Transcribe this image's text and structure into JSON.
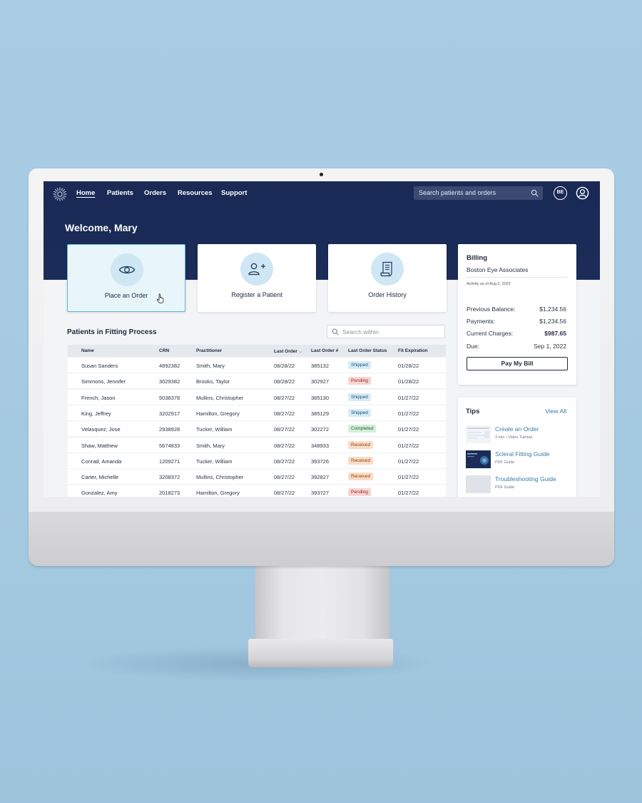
{
  "nav": {
    "items": [
      "Home",
      "Patients",
      "Orders",
      "Resources",
      "Support"
    ],
    "search_placeholder": "Search patients and orders",
    "avatar_initials": "BE"
  },
  "welcome": "Welcome, Mary",
  "actions": [
    "Place an Order",
    "Register a Patient",
    "Order History"
  ],
  "patients": {
    "title": "Patients in Fitting Process",
    "search_placeholder": "Search within",
    "columns": [
      "Name",
      "CRN",
      "Practitioner",
      "Last Order",
      "Last Order #",
      "Last Order Status",
      "Fit Expiration"
    ],
    "rows": [
      {
        "name": "Susan Sanders",
        "crn": "4892382",
        "practitioner": "Smith, Mary",
        "last_order": "08/28/22",
        "order_no": "385132",
        "status": "Shipped",
        "fit_exp": "01/28/22"
      },
      {
        "name": "Simmons, Jennifer",
        "crn": "3029382",
        "practitioner": "Brooks, Taylor",
        "last_order": "08/28/22",
        "order_no": "302927",
        "status": "Pending",
        "fit_exp": "01/28/22"
      },
      {
        "name": "French, Jason",
        "crn": "5038378",
        "practitioner": "Mullins, Christopher",
        "last_order": "08/27/22",
        "order_no": "385130",
        "status": "Shipped",
        "fit_exp": "01/27/22"
      },
      {
        "name": "King, Jeffrey",
        "crn": "3202917",
        "practitioner": "Hamilton, Gregory",
        "last_order": "08/27/22",
        "order_no": "385129",
        "status": "Shipped",
        "fit_exp": "01/27/22"
      },
      {
        "name": "Velasquez, Jose",
        "crn": "2938928",
        "practitioner": "Tucker, William",
        "last_order": "08/27/22",
        "order_no": "302272",
        "status": "Completed",
        "fit_exp": "01/27/22"
      },
      {
        "name": "Shaw, Matthew",
        "crn": "5674833",
        "practitioner": "Smith, Mary",
        "last_order": "08/27/22",
        "order_no": "348933",
        "status": "Received",
        "fit_exp": "01/27/22"
      },
      {
        "name": "Conrad, Amanda",
        "crn": "1209271",
        "practitioner": "Tucker, William",
        "last_order": "08/27/22",
        "order_no": "393726",
        "status": "Received",
        "fit_exp": "01/27/22"
      },
      {
        "name": "Carter, Michelle",
        "crn": "3208372",
        "practitioner": "Mullins, Christopher",
        "last_order": "08/27/22",
        "order_no": "392827",
        "status": "Received",
        "fit_exp": "01/27/22"
      },
      {
        "name": "Gonzalez, Amy",
        "crn": "2018273",
        "practitioner": "Hamilton, Gregory",
        "last_order": "08/27/22",
        "order_no": "393727",
        "status": "Pending",
        "fit_exp": "01/27/22"
      }
    ]
  },
  "billing": {
    "title": "Billing",
    "org": "Boston Eye Associates",
    "as_of": "Activity as of Aug 2, 2022",
    "lines": [
      {
        "label": "Previous Balance:",
        "value": "$1,234.56"
      },
      {
        "label": "Payments:",
        "value": "$1,234.56"
      },
      {
        "label": "Current Charges:",
        "value": "$987.65"
      },
      {
        "label": "Due:",
        "value": "Sep 1, 2022"
      }
    ],
    "pay_label": "Pay My Bill"
  },
  "tips": {
    "title": "Tips",
    "view_all": "View All",
    "items": [
      {
        "title": "Create an Order",
        "meta": "3 min • Video Tutorial"
      },
      {
        "title": "Scleral Fitting Guide",
        "meta": "PDF Guide"
      },
      {
        "title": "Troubleshooting Guide",
        "meta": "PDF Guide"
      }
    ]
  },
  "colors": {
    "nav_bg": "#1a2a55",
    "accent": "#3a7ca5",
    "shipped": "#d6ecf8",
    "pending": "#f8d5d3",
    "completed": "#d3efd9",
    "received": "#fbdcc6"
  }
}
